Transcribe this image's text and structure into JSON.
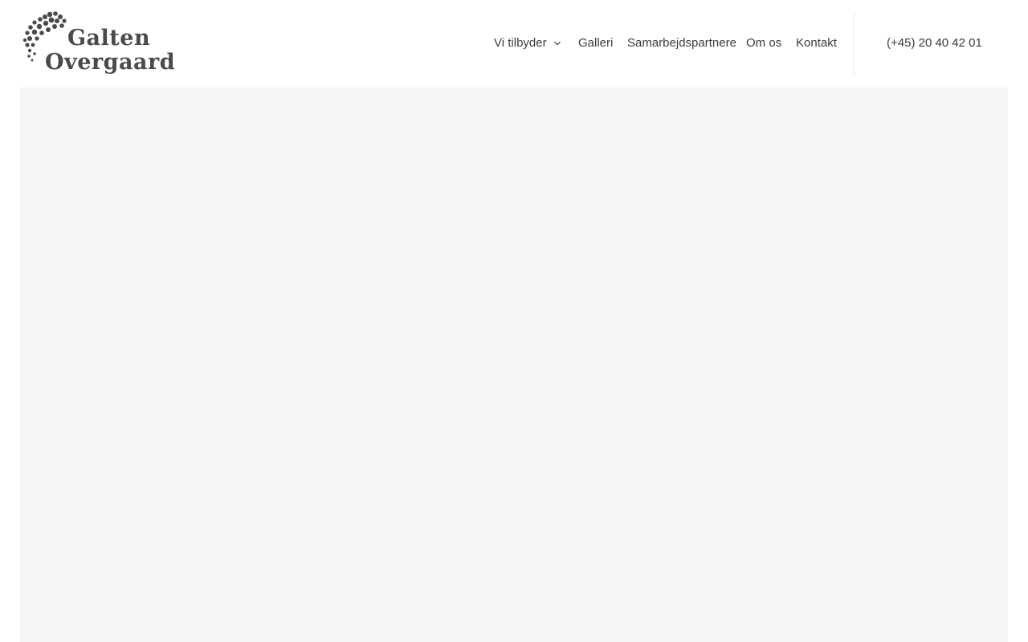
{
  "brand": {
    "line1": "Galten",
    "line2": "Overgaard",
    "logo_icon": "grape-cluster-icon",
    "color": "#4a4a4a"
  },
  "nav": {
    "items": [
      {
        "label": "Vi tilbyder",
        "has_dropdown": true
      },
      {
        "label": "Galleri"
      },
      {
        "label": "Samarbejdspartnere"
      },
      {
        "label": "Om os"
      },
      {
        "label": "Kontakt"
      }
    ]
  },
  "contact": {
    "phone": "(+45) 20 40 42 01"
  },
  "colors": {
    "text": "#3a3a3a",
    "hero_background": "#f5f5f5",
    "divider": "#ececec"
  }
}
